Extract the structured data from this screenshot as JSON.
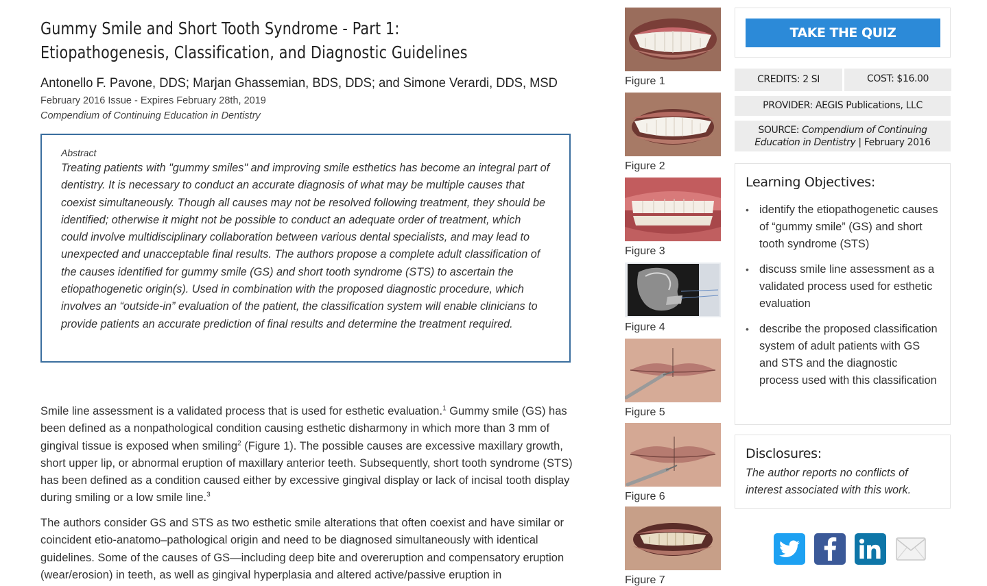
{
  "article": {
    "title_line1": "Gummy Smile and Short Tooth Syndrome - Part 1:",
    "title_line2": "Etiopathogenesis, Classification, and Diagnostic Guidelines",
    "authors": "Antonello F. Pavone, DDS; Marjan Ghassemian, BDS, DDS; and Simone Verardi, DDS, MSD",
    "issue": "February 2016 Issue - Expires February 28th, 2019",
    "journal": "Compendium of Continuing Education in Dentistry",
    "abstract_label": "Abstract",
    "abstract_text": "Treating patients with \"gummy smiles\" and improving smile esthetics has become an integral part of dentistry. It is necessary to conduct an accurate diagnosis of what may be multiple causes that coexist simultaneously. Though all causes may not be resolved following treatment, they should be identified; otherwise it might not be possible to conduct an adequate order of treatment, which could involve multidisciplinary collaboration between various dental specialists, and may lead to unexpected and unacceptable final results. The authors propose a complete adult classification of the causes identified for gummy smile (GS) and short tooth syndrome (STS) to ascertain the etiopathogenetic origin(s). Used in combination with the proposed diagnostic procedure, which involves an “outside-in” evaluation of the patient, the classification system will enable clinicians to provide patients an accurate prediction of final results and determine the treatment required.",
    "p1_a": "Smile line assessment is a validated process that is used for esthetic evaluation.",
    "p1_sup1": "1",
    "p1_b": " Gummy smile (GS) has been defined as a nonpathological condition causing esthetic disharmony in which more than 3 mm of gingival tissue is exposed when smiling",
    "p1_sup2": "2",
    "p1_c": " (Figure 1). The possible causes are excessive maxillary growth, short upper lip, or abnormal eruption of maxillary anterior teeth. Subsequently, short tooth syndrome (STS) has been defined as a condition caused either by excessive gingival display or lack of incisal tooth display during smiling or a low smile line.",
    "p1_sup3": "3",
    "p2": "The authors consider GS and STS as two esthetic smile alterations that often coexist and have similar or coincident etio-anatomo–pathological origin and need to be diagnosed simultaneously with identical guidelines. Some of the causes of GS—including deep bite and overeruption and compensatory eruption (wear/erosion) in teeth, as well as gingival hyperplasia and altered active/passive eruption in"
  },
  "figures": [
    {
      "caption": "Figure 1",
      "kind": "smile"
    },
    {
      "caption": "Figure 2",
      "kind": "smile"
    },
    {
      "caption": "Figure 3",
      "kind": "gums"
    },
    {
      "caption": "Figure 4",
      "kind": "xray"
    },
    {
      "caption": "Figure 5",
      "kind": "lips-probe"
    },
    {
      "caption": "Figure 6",
      "kind": "lips-probe"
    },
    {
      "caption": "Figure 7",
      "kind": "smile-worn"
    }
  ],
  "sidebar": {
    "quiz_label": "TAKE THE QUIZ",
    "credits": "CREDITS: 2 SI",
    "cost": "COST: $16.00",
    "provider": "PROVIDER: AEGIS Publications, LLC",
    "source_label": "SOURCE: ",
    "source_journal": "Compendium of Continuing Education in Dentistry",
    "source_sep": " | ",
    "source_date": "February 2016",
    "objectives_title": "Learning Objectives:",
    "objectives": [
      "identify the etiopathogenetic causes of “gummy smile” (GS) and short tooth syndrome (STS)",
      "discuss smile line assessment as a validated process used for esthetic evaluation",
      "describe the proposed classification system of adult patients with GS and STS and the diagnostic process used with this classification"
    ],
    "disclosures_title": "Disclosures:",
    "disclosures_text": "The author reports no conflicts of interest associated with this work."
  },
  "share": [
    {
      "icon": "twitter-icon",
      "color": "#1da1f2"
    },
    {
      "icon": "facebook-icon",
      "color": "#3b5998"
    },
    {
      "icon": "linkedin-icon",
      "color": "#0e76a8"
    },
    {
      "icon": "email-icon",
      "color": "#cccccc"
    }
  ],
  "colors": {
    "accent": "#2c8ad8",
    "abstract_border": "#3a6e9e",
    "meta_bg": "#ececec"
  }
}
